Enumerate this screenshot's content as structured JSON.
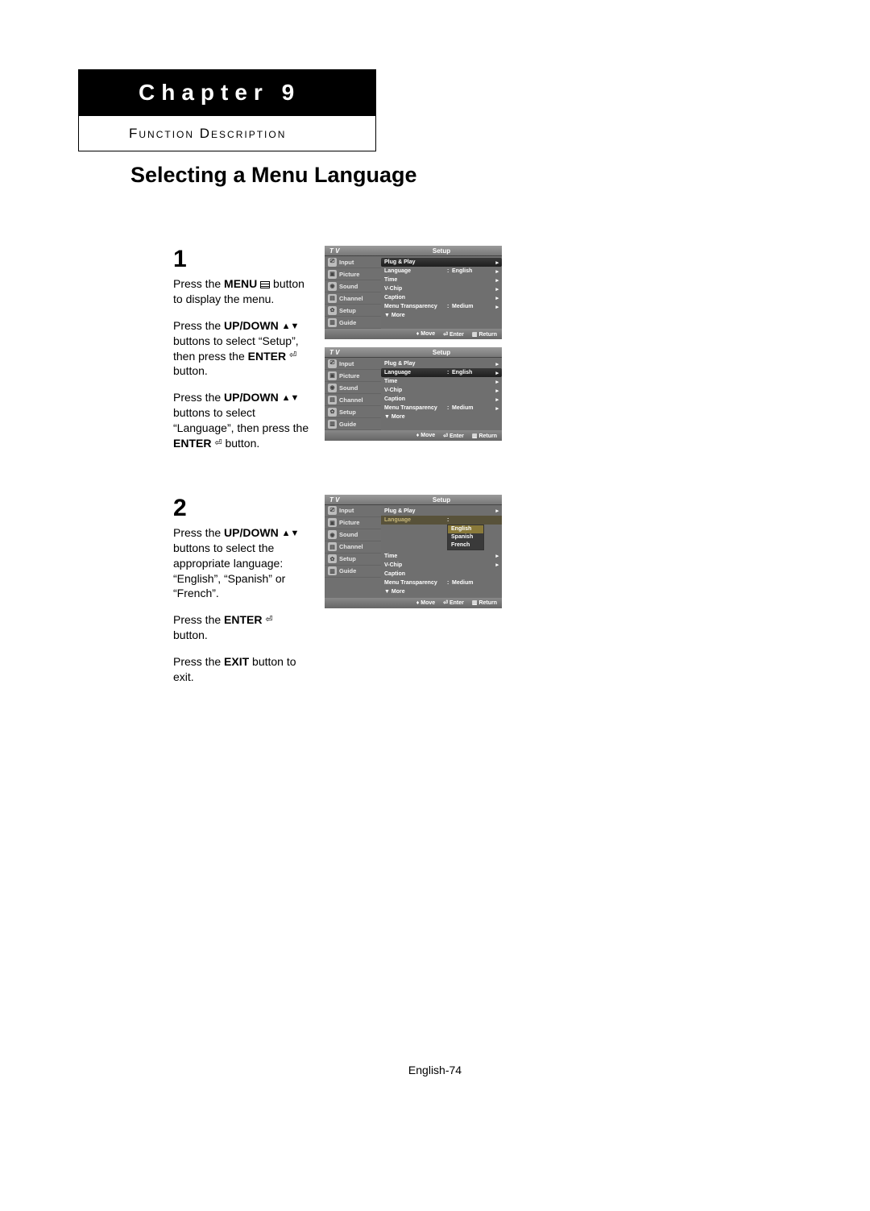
{
  "chapter_label": "Chapter 9",
  "section_label": "Function Description",
  "page_title": "Selecting a Menu Language",
  "page_footer": "English-74",
  "steps": {
    "s1": {
      "num": "1",
      "p1_a": "Press the ",
      "p1_b": "MENU",
      "p1_c": " button to display the menu.",
      "p2_a": "Press the ",
      "p2_b": "UP/DOWN",
      "p2_c": " buttons to select “Setup”, then press the ",
      "p2_d": "ENTER",
      "p2_e": " button.",
      "p3_a": "Press the ",
      "p3_b": "UP/DOWN",
      "p3_c": " buttons to select “Language”, then press the ",
      "p3_d": "ENTER",
      "p3_e": " button."
    },
    "s2": {
      "num": "2",
      "p1_a": "Press the ",
      "p1_b": "UP/DOWN",
      "p1_c": " buttons to select the appropriate language: “English”, “Spanish” or “French”.",
      "p2_a": "Press the ",
      "p2_b": "ENTER",
      "p2_c": " button.",
      "p3_a": "Press the ",
      "p3_b": "EXIT",
      "p3_c": " button to exit."
    }
  },
  "osd": {
    "tv": "T V",
    "setup": "Setup",
    "side": [
      "Input",
      "Picture",
      "Sound",
      "Channel",
      "Setup",
      "Guide"
    ],
    "rows": {
      "plug": "Plug & Play",
      "language": "Language",
      "lang_val": "English",
      "time": "Time",
      "vchip": "V-Chip",
      "caption": "Caption",
      "trans": "Menu Transparency",
      "trans_val": "Medium",
      "more": "▼ More"
    },
    "langs": [
      "English",
      "Spanish",
      "French"
    ],
    "footer": {
      "move": "Move",
      "enter": "Enter",
      "return": "Return"
    }
  }
}
